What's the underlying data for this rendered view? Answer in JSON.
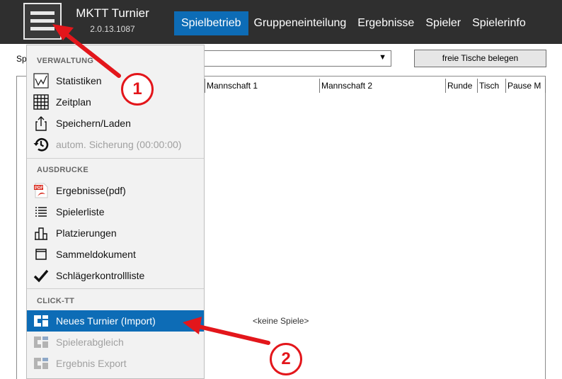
{
  "app": {
    "title": "MKTT Turnier",
    "version": "2.0.13.1087"
  },
  "nav": [
    {
      "label": "Spielbetrieb",
      "active": true
    },
    {
      "label": "Gruppeneinteilung",
      "active": false
    },
    {
      "label": "Ergebnisse",
      "active": false
    },
    {
      "label": "Spieler",
      "active": false
    },
    {
      "label": "Spielerinfo",
      "active": false
    }
  ],
  "filter": {
    "label": "Sp",
    "dropdown_value": "",
    "dropdown_arrow": "▼"
  },
  "free_tables_button": "freie Tische belegen",
  "table": {
    "headers": [
      "",
      "Mannschaft 1",
      "Mannschaft 2",
      "Runde",
      "Tisch",
      "Pause M"
    ],
    "empty_message": "<keine Spiele>"
  },
  "menu": {
    "sections": [
      {
        "title": "VERWALTUNG",
        "items": [
          {
            "label": "Statistiken",
            "icon": "chart-icon",
            "enabled": true
          },
          {
            "label": "Zeitplan",
            "icon": "grid-icon",
            "enabled": true
          },
          {
            "label": "Speichern/Laden",
            "icon": "share-icon",
            "enabled": true
          },
          {
            "label": "autom. Sicherung (00:00:00)",
            "icon": "history-icon",
            "enabled": false
          }
        ]
      },
      {
        "title": "AUSDRUCKE",
        "items": [
          {
            "label": "Ergebnisse(pdf)",
            "icon": "pdf-icon",
            "enabled": true
          },
          {
            "label": "Spielerliste",
            "icon": "list-icon",
            "enabled": true
          },
          {
            "label": "Platzierungen",
            "icon": "ranking-icon",
            "enabled": true
          },
          {
            "label": "Sammeldokument",
            "icon": "document-icon",
            "enabled": true
          },
          {
            "label": "Schlägerkontrollliste",
            "icon": "checkmark-icon",
            "enabled": true
          }
        ]
      },
      {
        "title": "CLICK-TT",
        "items": [
          {
            "label": "Neues Turnier (Import)",
            "icon": "clicktt-icon",
            "enabled": true,
            "highlighted": true
          },
          {
            "label": "Spielerabgleich",
            "icon": "clicktt-icon",
            "enabled": false
          },
          {
            "label": "Ergebnis Export",
            "icon": "clicktt-icon",
            "enabled": false
          }
        ]
      }
    ]
  },
  "annotations": {
    "badge_1": "1",
    "badge_2": "2",
    "color": "#e3161b"
  },
  "colors": {
    "topbar": "#2f2f2f",
    "accent": "#0d6cb6",
    "menu_bg": "#f2f2f2"
  }
}
